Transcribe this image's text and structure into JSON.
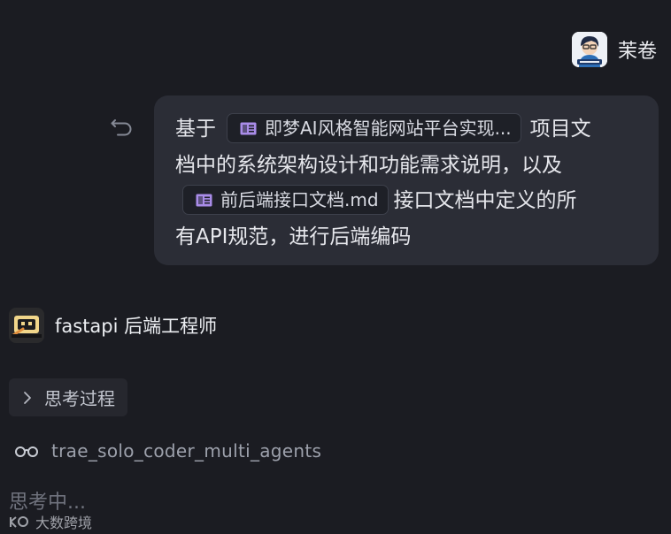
{
  "user": {
    "name": "茉卷",
    "avatar_icon": "cartoon-user-avatar"
  },
  "message": {
    "text_before_chip1": "基于",
    "chip1_label": "即梦AI风格智能网站平台实现...",
    "text_after_chip1_line1": "项目文",
    "text_line2": "档中的系统架构设计和功能需求说明，以及",
    "chip2_label": "前后端接口文档.md",
    "text_after_chip2": "接口文档中定义的所",
    "text_line4": "有API规范，进行后端编码",
    "chip_icon": "document-icon",
    "chip_icon_color": "#a98ce8",
    "undo_icon": "undo-icon"
  },
  "agent": {
    "name": "fastapi 后端工程师",
    "avatar_icon": "robot-avatar"
  },
  "thinking_section": {
    "label": "思考过程",
    "icon": "chevron-right-icon"
  },
  "tool_call": {
    "icon": "glasses-icon",
    "name": "trae_solo_coder_multi_agents"
  },
  "status": {
    "text": "思考中..."
  },
  "watermark": {
    "text": "大数跨境"
  }
}
